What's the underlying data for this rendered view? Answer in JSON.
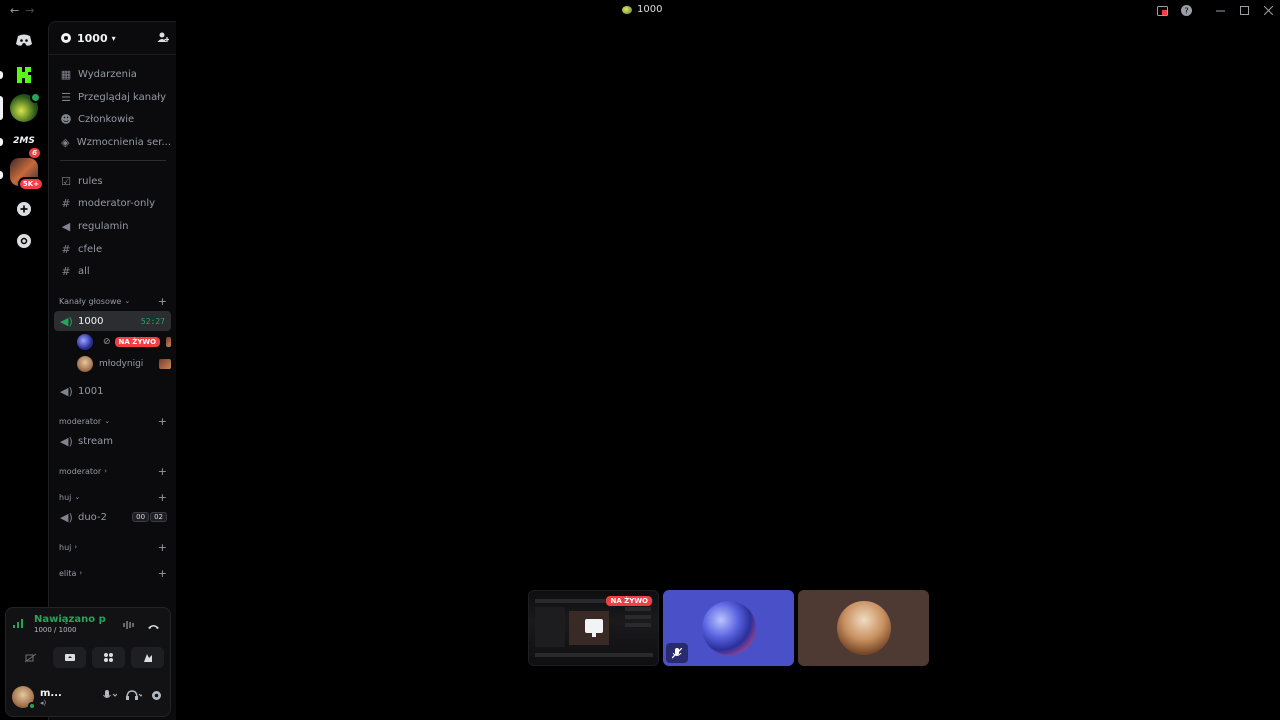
{
  "titlebar": {
    "back": "←",
    "forward": "→",
    "title": "1000"
  },
  "guild": {
    "name": "1000"
  },
  "menu": [
    {
      "label": "Wydarzenia",
      "icon": "calendar-icon"
    },
    {
      "label": "Przeglądaj kanały",
      "icon": "browse-icon"
    },
    {
      "label": "Członkowie",
      "icon": "members-icon"
    },
    {
      "label": "Wzmocnienia ser...",
      "icon": "boost-icon"
    }
  ],
  "text_channels": [
    {
      "label": "rules",
      "icon": "rules-icon"
    },
    {
      "label": "moderator-only",
      "icon": "hash-icon"
    },
    {
      "label": "regulamin",
      "icon": "announcement-icon"
    },
    {
      "label": "cfele",
      "icon": "hash-icon"
    },
    {
      "label": "all",
      "icon": "hash-icon"
    }
  ],
  "voice_category": {
    "label": "Kanały głosowe"
  },
  "voice_channel_active": {
    "label": "1000",
    "timer": "52:27"
  },
  "voice_users": [
    {
      "name": "",
      "badge": "NA ŻYWO"
    },
    {
      "name": "młodynigi"
    }
  ],
  "voice_channel_2": {
    "label": "1001"
  },
  "cat_moderator_1": {
    "label": "moderator"
  },
  "stream_channel": {
    "label": "stream"
  },
  "cat_moderator_2": {
    "label": "moderator"
  },
  "cat_huj_1": {
    "label": "huj"
  },
  "duo_channel": {
    "label": "duo-2",
    "count_a": "00",
    "count_b": "02"
  },
  "cat_huj_2": {
    "label": "huj"
  },
  "cat_elita": {
    "label": "elita"
  },
  "rail_badges": {
    "server3": "6",
    "server4": "5K+"
  },
  "voice_panel": {
    "status": "Nawiązano poł...",
    "channel": "1000 / 1000",
    "username": "m...",
    "user_sub": "◂)"
  },
  "tiles": {
    "live_label": "NA ŻYWO"
  },
  "colors": {
    "accent_green": "#23a55a",
    "live_red": "#f23f43",
    "tile_blue": "#4a51c8",
    "tile_brown": "#4e3a33"
  }
}
